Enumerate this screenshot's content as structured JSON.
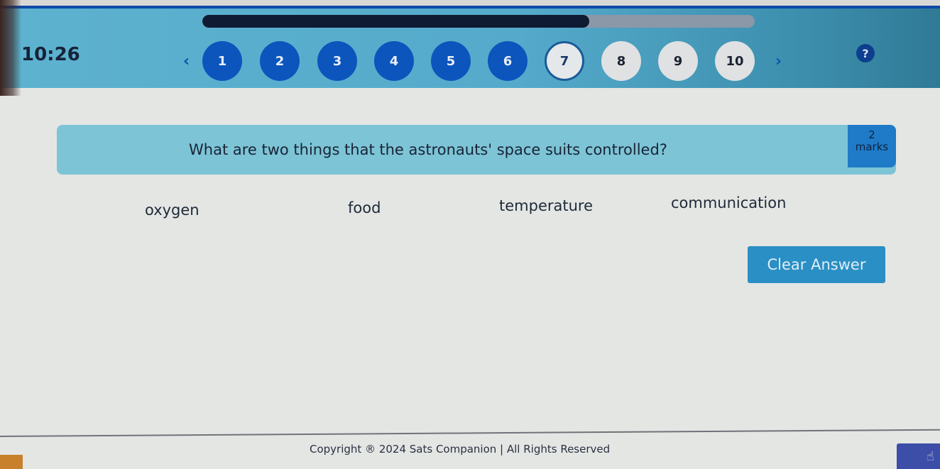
{
  "header": {
    "progress_percent": 70,
    "timer": "10:26",
    "prev_arrow": "‹",
    "next_arrow": "›",
    "help_icon": "?",
    "questions": [
      {
        "label": "1",
        "state": "done"
      },
      {
        "label": "2",
        "state": "done"
      },
      {
        "label": "3",
        "state": "done"
      },
      {
        "label": "4",
        "state": "done"
      },
      {
        "label": "5",
        "state": "done"
      },
      {
        "label": "6",
        "state": "done"
      },
      {
        "label": "7",
        "state": "current"
      },
      {
        "label": "8",
        "state": "todo"
      },
      {
        "label": "9",
        "state": "todo"
      },
      {
        "label": "10",
        "state": "todo"
      }
    ]
  },
  "question": {
    "text": "What are two things that the astronauts' space suits controlled?",
    "marks_value": "2",
    "marks_label": "marks"
  },
  "options": [
    "oxygen",
    "food",
    "temperature",
    "communication"
  ],
  "clear_button": "Clear Answer",
  "footer": {
    "copyright": "Copyright ® 2024 Sats Companion | All Rights Reserved"
  },
  "cursor_icon": "☝"
}
